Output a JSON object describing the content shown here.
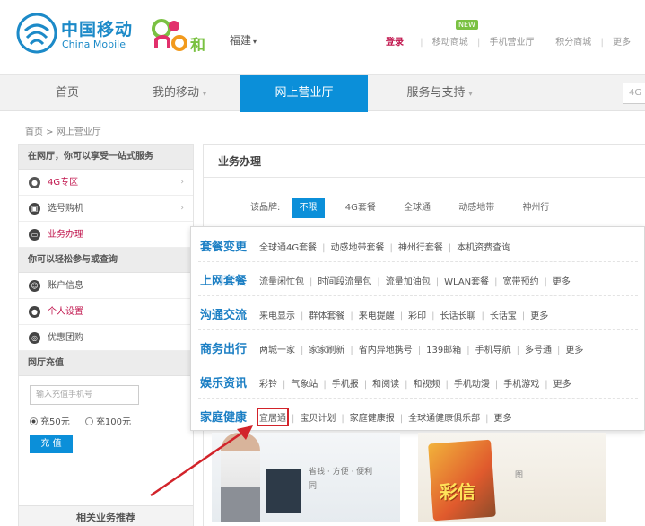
{
  "header": {
    "brand_cn": "中国移动",
    "brand_en": "China Mobile",
    "and_brand": "和",
    "city": "福建",
    "new_badge": "NEW",
    "login": "登录",
    "links": [
      "移动商城",
      "手机营业厅",
      "积分商城",
      "更多"
    ]
  },
  "nav": {
    "items": [
      {
        "label": "首页",
        "caret": false,
        "active": false
      },
      {
        "label": "我的移动",
        "caret": true,
        "active": false
      },
      {
        "label": "网上营业厅",
        "caret": false,
        "active": true
      },
      {
        "label": "服务与支持",
        "caret": true,
        "active": false
      }
    ],
    "search_placeholder": "4G"
  },
  "breadcrumb": "首页 > 网上营业厅",
  "sidebar": {
    "head1": "在网厅，你可以享受一站式服务",
    "group1": [
      {
        "label": "4G专区",
        "icon": "4g-icon",
        "red": true
      },
      {
        "label": "选号购机",
        "icon": "phone-icon",
        "red": false
      },
      {
        "label": "业务办理",
        "icon": "service-icon",
        "red": true
      }
    ],
    "head2": "你可以轻松参与或查询",
    "group2": [
      {
        "label": "账户信息",
        "icon": "account-icon",
        "red": false
      },
      {
        "label": "个人设置",
        "icon": "user-icon",
        "red": true
      },
      {
        "label": "优惠团购",
        "icon": "discount-icon",
        "red": false
      }
    ],
    "recharge_title": "网厅充值",
    "recharge_placeholder": "输入充值手机号",
    "amounts": [
      "充50元",
      "充100元"
    ],
    "recharge_button": "充 值",
    "bottom_title": "相关业务推荐"
  },
  "main": {
    "title": "业务办理",
    "filter_label": "该品牌:",
    "filter_chips": [
      "不限",
      "4G套餐",
      "全球通",
      "动感地带",
      "神州行"
    ]
  },
  "dropdown": {
    "rows": [
      {
        "cat": "套餐变更",
        "links": [
          "全球通4G套餐",
          "动感地带套餐",
          "神州行套餐",
          "本机资费查询"
        ]
      },
      {
        "cat": "上网套餐",
        "links": [
          "流量闲忙包",
          "时间段流量包",
          "流量加油包",
          "WLAN套餐",
          "宽带预约",
          "更多"
        ]
      },
      {
        "cat": "沟通交流",
        "links": [
          "来电显示",
          "群体套餐",
          "来电提醒",
          "彩印",
          "长话长聊",
          "长话宝",
          "更多"
        ]
      },
      {
        "cat": "商务出行",
        "links": [
          "两城一家",
          "家家刷新",
          "省内异地携号",
          "139邮箱",
          "手机导航",
          "多号通",
          "更多"
        ]
      },
      {
        "cat": "娱乐资讯",
        "links": [
          "彩铃",
          "气象站",
          "手机报",
          "和阅读",
          "和视频",
          "手机动漫",
          "手机游戏",
          "更多"
        ]
      },
      {
        "cat": "家庭健康",
        "links": [
          "宜居通",
          "宝贝计划",
          "家庭健康报",
          "全球通健康俱乐部",
          "更多"
        ]
      }
    ]
  },
  "promos": {
    "promo1_text": "省钱 · 方便 · 便利",
    "promo1_text2": "同",
    "promo2_art": "彩信",
    "promo2_text": "图"
  }
}
